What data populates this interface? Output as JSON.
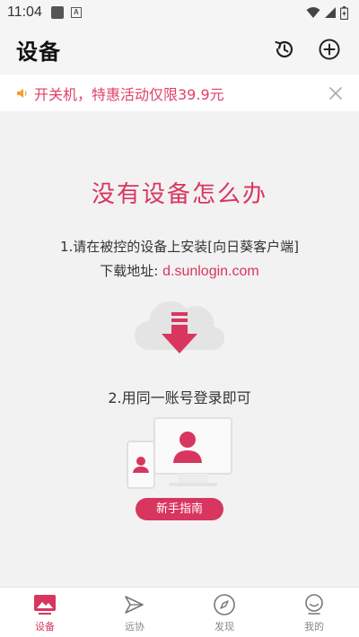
{
  "status_bar": {
    "time": "11:04",
    "a_badge": "A",
    "icons": [
      "wifi-icon",
      "signal-icon",
      "battery-icon"
    ]
  },
  "header": {
    "title": "设备",
    "actions": [
      "history-icon",
      "add-circle-icon"
    ]
  },
  "promo": {
    "text": "开关机，特惠活动仅限39.9元",
    "icon": "speaker-icon",
    "close_icon": "close-icon"
  },
  "empty_state": {
    "title": "没有设备怎么办",
    "step1": "1.请在被控的设备上安装[向日葵客户端]",
    "download_label": "下载地址:",
    "download_link": "d.sunlogin.com",
    "step2": "2.用同一账号登录即可",
    "guide_button": "新手指南"
  },
  "tabs": [
    {
      "label": "设备",
      "icon": "device-icon",
      "active": true
    },
    {
      "label": "远协",
      "icon": "remote-assist-icon",
      "active": false
    },
    {
      "label": "发现",
      "icon": "compass-icon",
      "active": false
    },
    {
      "label": "我的",
      "icon": "profile-icon",
      "active": false
    }
  ],
  "colors": {
    "accent": "#d8365f",
    "background": "#f2f2f2",
    "illustration_gray": "#e4e4e4"
  }
}
